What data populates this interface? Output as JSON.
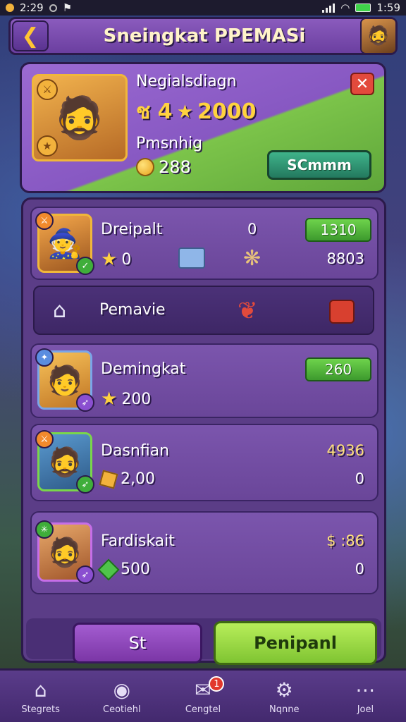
{
  "status": {
    "time": "2:29",
    "clock": "1:59"
  },
  "header": {
    "back_icon": "back-arrow-icon",
    "title": "Sneingkat PPEMASi"
  },
  "profile": {
    "name": "Negialsdiagn",
    "rank_prefix": "ช 4",
    "rank_value": "2000",
    "sub": "Pmsnhig",
    "coins": "288",
    "action_label": "SCmmm"
  },
  "rows": [
    {
      "name": "Dreipalt",
      "mid_value": "0",
      "pill": "1310",
      "stat": "0",
      "right_value": "8803"
    },
    {
      "name": "Demingkat",
      "pill": "260",
      "stat": "200"
    },
    {
      "name": "Dasnfian",
      "right_top": "4936",
      "stat": "2,00",
      "right_bottom": "0"
    },
    {
      "name": "Fardiskait",
      "right_top": "$ :86",
      "stat": "500",
      "right_bottom": "0"
    }
  ],
  "filter": {
    "label": "Pemavie"
  },
  "buttons": {
    "secondary": "St",
    "primary": "Penipanl"
  },
  "nav": [
    {
      "label": "Stegrets",
      "icon": "home-icon"
    },
    {
      "label": "Ceotiehl",
      "icon": "ninja-face-icon"
    },
    {
      "label": "Cengtel",
      "icon": "mail-icon",
      "badge": "1"
    },
    {
      "label": "Nqnne",
      "icon": "gear-icon"
    },
    {
      "label": "Joel",
      "icon": "chat-bubble-icon"
    }
  ]
}
